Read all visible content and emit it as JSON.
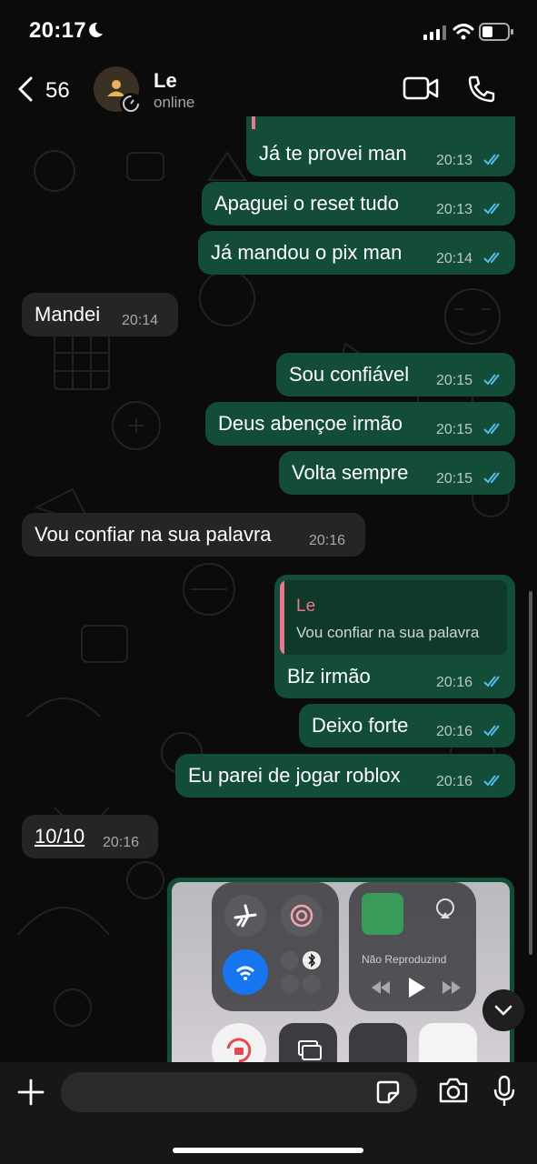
{
  "status_bar": {
    "time": "20:17"
  },
  "header": {
    "back_count": "56",
    "contact_name": "Le",
    "presence": "online"
  },
  "messages": [
    {
      "dir": "out",
      "text": "Já te provei man",
      "time": "20:13"
    },
    {
      "dir": "out",
      "text": "Apaguei o reset tudo",
      "time": "20:13"
    },
    {
      "dir": "out",
      "text": "Já mandou o pix man",
      "time": "20:14"
    },
    {
      "dir": "in",
      "text": "Mandei",
      "time": "20:14"
    },
    {
      "dir": "out",
      "text": "Sou confiável",
      "time": "20:15"
    },
    {
      "dir": "out",
      "text": "Deus abençoe irmão",
      "time": "20:15"
    },
    {
      "dir": "out",
      "text": "Volta sempre",
      "time": "20:15"
    },
    {
      "dir": "in",
      "text": "Vou confiar na sua palavra",
      "time": "20:16"
    },
    {
      "dir": "out",
      "text": "Blz irmão",
      "time": "20:16",
      "reply": {
        "name": "Le",
        "text": "Vou confiar na sua palavra"
      }
    },
    {
      "dir": "out",
      "text": "Deixo forte",
      "time": "20:16"
    },
    {
      "dir": "out",
      "text": "Eu parei de jogar roblox",
      "time": "20:16"
    },
    {
      "dir": "in",
      "text": "10/10",
      "time": "20:16"
    }
  ],
  "image_message": {
    "now_playing_text": "Não Reproduzind"
  },
  "composer": {
    "placeholder": ""
  },
  "colors": {
    "outgoing_bubble": "#134d37",
    "incoming_bubble": "#252525",
    "read_tick": "#53bdeb",
    "reply_accent": "#e8788f"
  }
}
